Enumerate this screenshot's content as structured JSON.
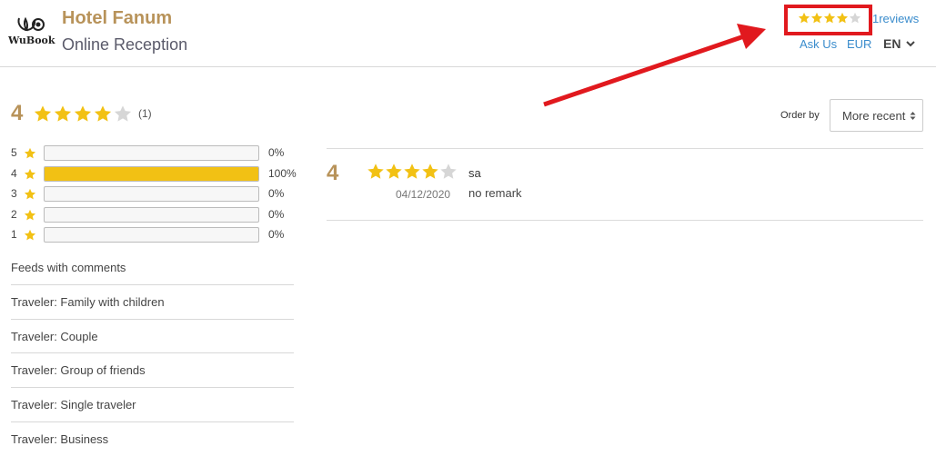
{
  "header": {
    "logo_text": "WuBook",
    "hotel_name": "Hotel Fanum",
    "subtitle": "Online Reception",
    "rating_stars": 4,
    "reviews_link": "1reviews",
    "ask_us": "Ask Us",
    "currency": "EUR",
    "language": "EN"
  },
  "summary": {
    "average": "4",
    "stars": 4,
    "count": "(1)",
    "distribution": [
      {
        "stars": "5",
        "percent_label": "0%",
        "percent": 0
      },
      {
        "stars": "4",
        "percent_label": "100%",
        "percent": 100
      },
      {
        "stars": "3",
        "percent_label": "0%",
        "percent": 0
      },
      {
        "stars": "2",
        "percent_label": "0%",
        "percent": 0
      },
      {
        "stars": "1",
        "percent_label": "0%",
        "percent": 0
      }
    ]
  },
  "filters": [
    "Feeds with comments",
    "Traveler: Family with children",
    "Traveler: Couple",
    "Traveler: Group of friends",
    "Traveler: Single traveler",
    "Traveler: Business"
  ],
  "sort": {
    "label": "Order by",
    "selected": "More recent"
  },
  "reviews": [
    {
      "score": "4",
      "stars": 4,
      "date": "04/12/2020",
      "title": "sa",
      "text": "no remark"
    }
  ],
  "colors": {
    "accent": "#b8935a",
    "star": "#f2c114",
    "star_empty": "#d6d6d6",
    "link": "#3a8ccc",
    "highlight": "#e1191e"
  }
}
